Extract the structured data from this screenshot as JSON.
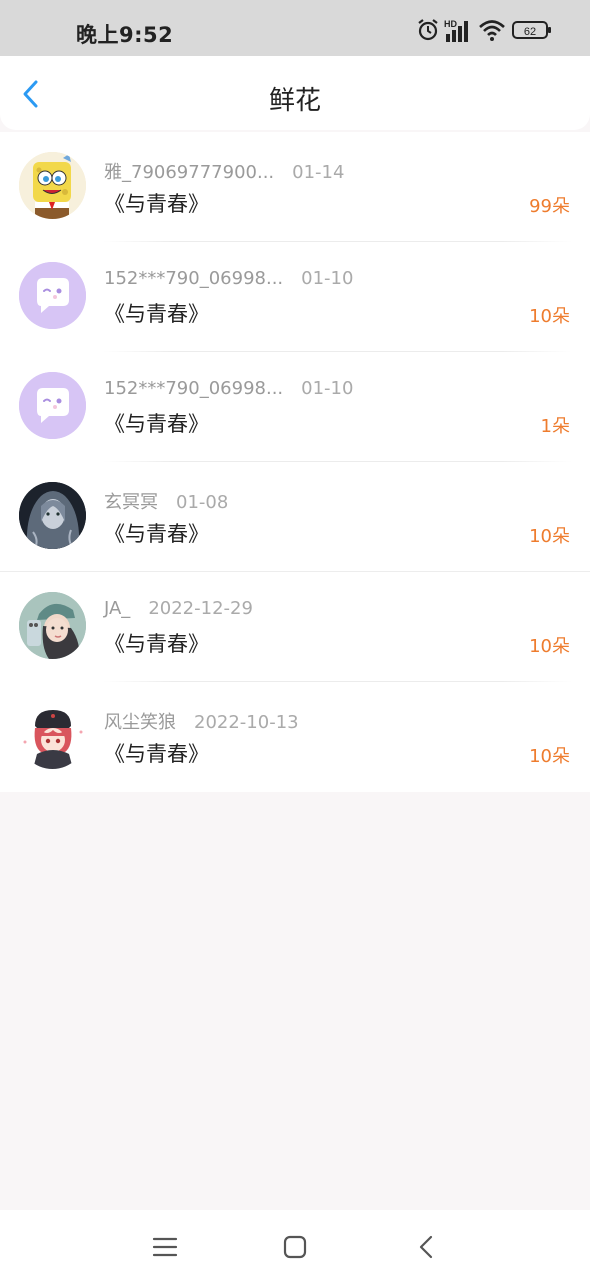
{
  "status_bar": {
    "time": "晚上9:52",
    "network_label": "HD",
    "battery_level": "62",
    "icons": [
      "alarm-icon",
      "signal-icon",
      "wifi-icon",
      "battery-icon"
    ]
  },
  "header": {
    "title": "鲜花",
    "back_icon": "chevron-left-icon"
  },
  "records": [
    {
      "name": "雅_79069777900...",
      "date": "01-14",
      "book": "《与青春》",
      "flowers": "99朵",
      "avatar": "spongebob-avatar"
    },
    {
      "name": "152***790_06998...",
      "date": "01-10",
      "book": "《与青春》",
      "flowers": "10朵",
      "avatar": "default-chat-avatar"
    },
    {
      "name": "152***790_06998...",
      "date": "01-10",
      "book": "《与青春》",
      "flowers": "1朵",
      "avatar": "default-chat-avatar"
    },
    {
      "name": "玄冥冥",
      "date": "01-08",
      "book": "《与青春》",
      "flowers": "10朵",
      "avatar": "dark-portrait-avatar"
    },
    {
      "name": "JA_",
      "date": "2022-12-29",
      "book": "《与青春》",
      "flowers": "10朵",
      "avatar": "selfie-photo-avatar"
    },
    {
      "name": "风尘笑狼",
      "date": "2022-10-13",
      "book": "《与青春》",
      "flowers": "10朵",
      "avatar": "anime-boy-avatar"
    }
  ],
  "nav_bar": {
    "icons": [
      "menu-icon",
      "home-icon",
      "back-icon"
    ]
  },
  "colors": {
    "accent_blue": "#2b9af3",
    "flower_orange": "#ee7c2e",
    "default_avatar_purple": "#d7c5f5"
  }
}
